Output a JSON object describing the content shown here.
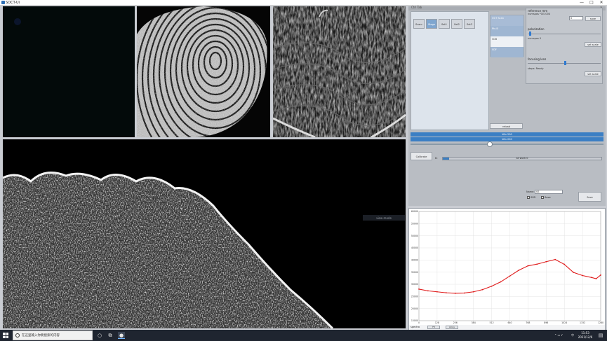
{
  "window": {
    "title": "SOCT-Ui",
    "controls": [
      "—",
      "□",
      "✕"
    ]
  },
  "control_panel": {
    "header": "Ctrl Tab",
    "close": "✕",
    "tabs": [
      {
        "label": "Scanr",
        "active": false
      },
      {
        "label": "Stage",
        "active": true
      },
      {
        "label": "Set1",
        "active": false
      },
      {
        "label": "Set2",
        "active": false
      },
      {
        "label": "Set3",
        "active": false
      }
    ],
    "list_items": [
      "OCT Scan",
      "Pts B",
      "SDB",
      "SDF"
    ],
    "reference_group": {
      "title": "reference mm",
      "value": "numspos *1E1004",
      "input_value": "0",
      "button": "save"
    },
    "polarization_group": {
      "title": "polarization",
      "value": "numspos 0",
      "button": "set scale"
    },
    "focusing_group": {
      "title": "focusing lens",
      "value": "steps: Ready",
      "button": "set scale"
    },
    "reload_button": "reload",
    "bars": [
      "Win 200",
      "Win 200"
    ],
    "slider_value": 0.41,
    "calibrate_button": "Calibrate",
    "progress_label": "B:",
    "progress_text": "all work 0",
    "progress_value": 0.04,
    "name_label": "Name:",
    "name_value": "SS",
    "checks": [
      {
        "label": "SSD"
      },
      {
        "label": "Save"
      }
    ],
    "save_button": "Save"
  },
  "chart_data": {
    "type": "line",
    "y_tick_labels": [
      "60000",
      "55000",
      "50000",
      "45000",
      "40000",
      "35000",
      "30000",
      "25000",
      "20000",
      "15000"
    ],
    "x_tick_labels": [
      "0",
      "128",
      "256",
      "384",
      "512",
      "640",
      "768",
      "896",
      "1024",
      "1152",
      "1280"
    ],
    "xlim": [
      0,
      1280
    ],
    "ylim": [
      15000,
      60000
    ],
    "x": [
      0,
      64,
      128,
      192,
      256,
      320,
      384,
      448,
      512,
      576,
      640,
      704,
      768,
      832,
      896,
      960,
      1024,
      1088,
      1152,
      1216,
      1248,
      1280
    ],
    "values": [
      28000,
      27300,
      26900,
      26500,
      26300,
      26400,
      26900,
      27800,
      29200,
      31000,
      33400,
      35800,
      37600,
      38300,
      39300,
      40200,
      38200,
      34900,
      33600,
      32800,
      32300,
      33800
    ],
    "color": "#e01b1b",
    "footer_label": "spectra",
    "footer_buttons": [
      "Fit",
      "Array"
    ]
  },
  "overlay_label": "view mode",
  "taskbar": {
    "search_placeholder": "在这里输入你要搜索的内容",
    "tray_text": "中",
    "time": "11:53",
    "date": "2021/12/6"
  }
}
